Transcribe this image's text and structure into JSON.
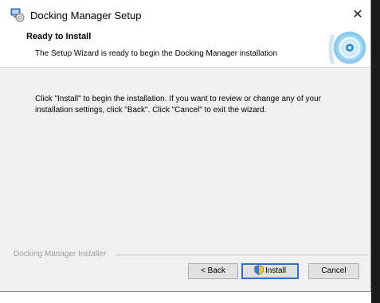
{
  "window": {
    "title": "Docking Manager Setup",
    "close_glyph": "✕"
  },
  "header": {
    "title": "Ready to Install",
    "subtitle": "The Setup Wizard is ready to begin the Docking Manager installation"
  },
  "body": {
    "line1": "Click \"Install\" to begin the installation.  If you want to review or change any of your",
    "line2": "installation settings, click \"Back\".  Click \"Cancel\" to exit the wizard."
  },
  "footer": {
    "installer_label": "Docking Manager Installer"
  },
  "buttons": {
    "back": "< Back",
    "install": "Install",
    "cancel": "Cancel"
  },
  "icons": {
    "app": "installer-icon",
    "close": "close-icon",
    "header_art": "cd-disc-icon",
    "install_shield": "uac-shield-icon"
  },
  "colors": {
    "focus_border": "#2f6fc7",
    "dialog_bg": "#f0f0f0"
  }
}
